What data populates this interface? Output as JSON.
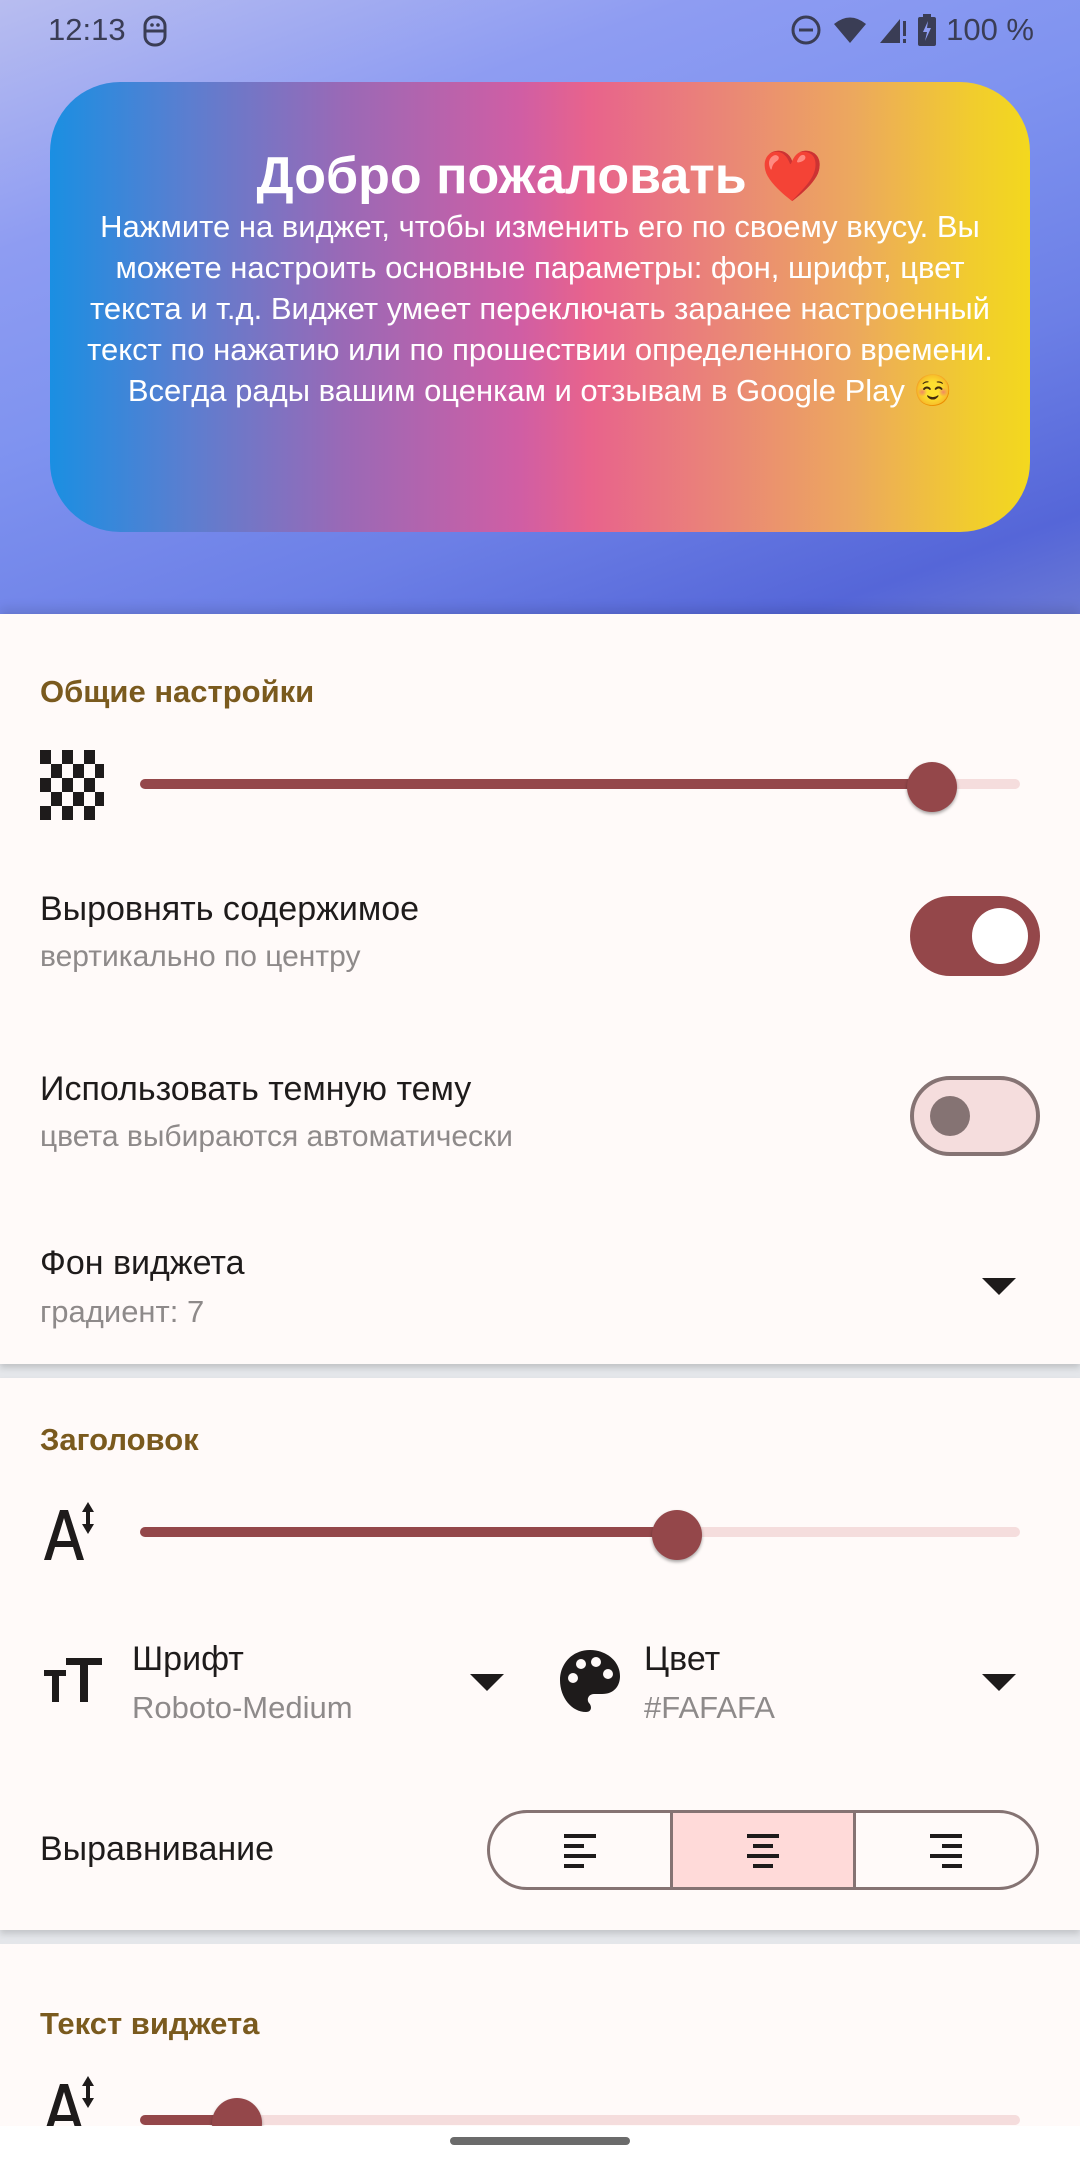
{
  "status_bar": {
    "time": "12:13",
    "left_icon": "sync-app-icon",
    "right_icons": [
      "dnd-icon",
      "wifi-icon",
      "signal-no-data-icon",
      "battery-charging-icon"
    ],
    "battery": "100 %"
  },
  "widget_preview": {
    "title": "Добро пожаловать",
    "title_emoji": "❤️",
    "text": "Нажмите на виджет, чтобы изменить его по своему вкусу. Вы можете настроить основные параметры: фон, шрифт, цвет текста и т.д. Виджет умеет переключать заранее настроенный текст по нажатию или по прошествии определенного времени. Всегда рады вашим оценкам и отзывам в Google Play ☺️",
    "gradient_colors": [
      "#1A8FE2",
      "#9A69B6",
      "#E8638C",
      "#ECA85E",
      "#F3D81E"
    ]
  },
  "general": {
    "title": "Общие настройки",
    "transparency_slider": {
      "icon": "transparency-checker-icon",
      "value_fraction": 0.9
    },
    "align_content": {
      "title": "Выровнять содержимое",
      "subtitle": "вертикально по центру",
      "checked": true
    },
    "dark_theme": {
      "title": "Использовать темную тему",
      "subtitle": "цвета выбираются автоматически",
      "checked": false
    },
    "background": {
      "title": "Фон виджета",
      "value": "градиент: 7"
    }
  },
  "header_section": {
    "title": "Заголовок",
    "size_slider": {
      "icon": "text-size-icon",
      "value_fraction": 0.61
    },
    "font": {
      "label": "Шрифт",
      "value": "Roboto-Medium",
      "icon": "font-icon"
    },
    "color": {
      "label": "Цвет",
      "value": "#FAFAFA",
      "icon": "palette-icon"
    },
    "alignment": {
      "label": "Выравнивание",
      "options": [
        "left",
        "center",
        "right"
      ],
      "selected": "center"
    }
  },
  "text_section": {
    "title": "Текст виджета",
    "size_slider": {
      "icon": "text-size-icon",
      "value_fraction": 0.11
    }
  },
  "colors": {
    "accent": "#94474A",
    "accent_track": "#F5DDDD",
    "section_title": "#7A5A1E",
    "surface": "#FFFAF9",
    "segment_selected": "#FFDAD9"
  }
}
